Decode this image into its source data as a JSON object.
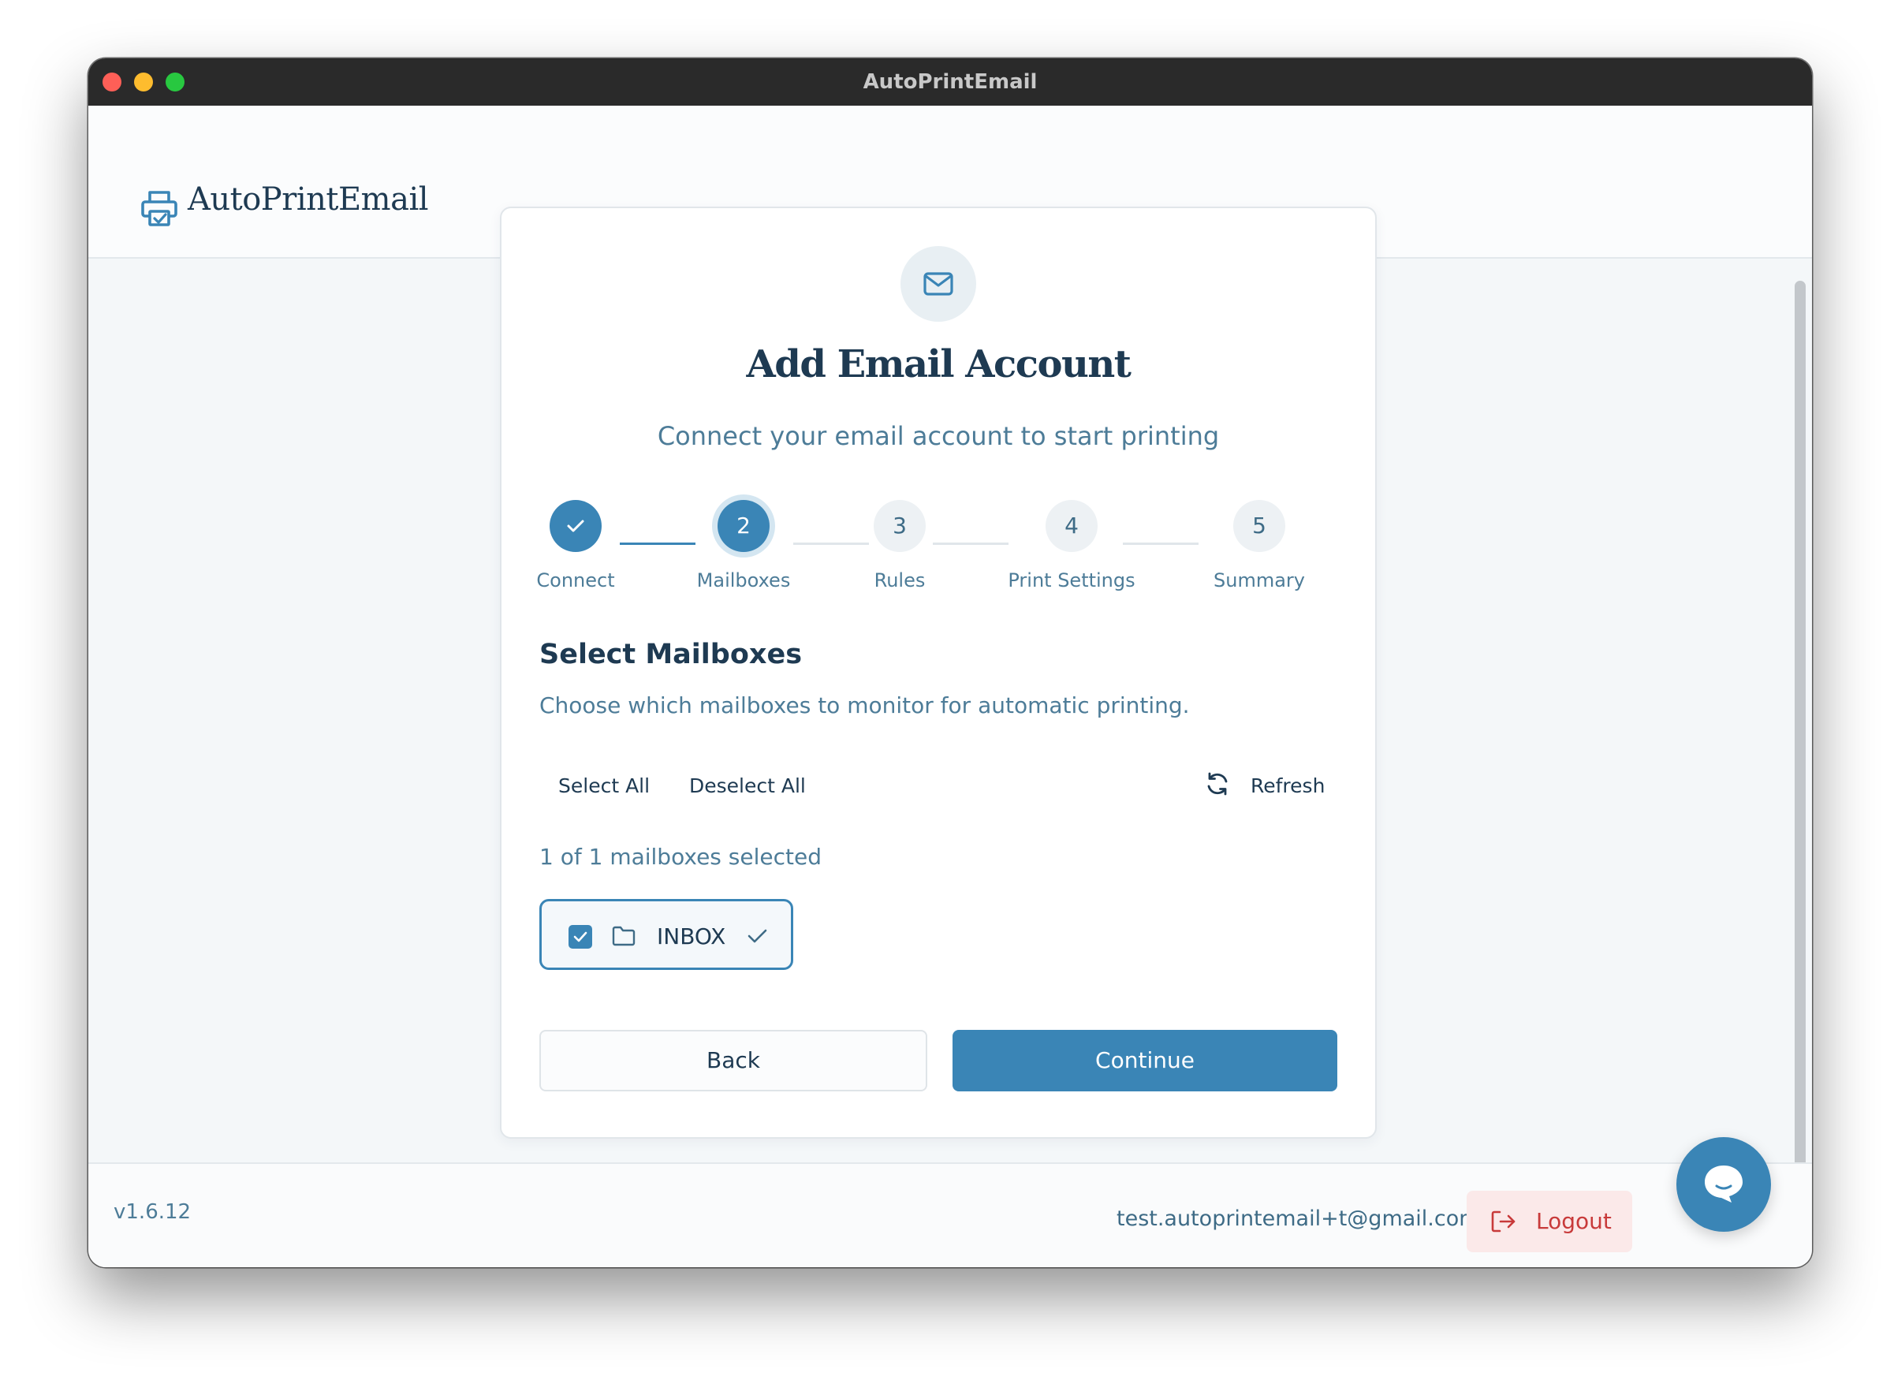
{
  "window": {
    "title": "AutoPrintEmail"
  },
  "header": {
    "app_name": "AutoPrintEmail",
    "logo_icon": "printer-icon"
  },
  "card": {
    "icon": "mail-icon",
    "title": "Add Email Account",
    "subtitle": "Connect your email account to start printing"
  },
  "stepper": {
    "steps": [
      {
        "number": "1",
        "label": "Connect",
        "state": "done"
      },
      {
        "number": "2",
        "label": "Mailboxes",
        "state": "active"
      },
      {
        "number": "3",
        "label": "Rules",
        "state": "todo"
      },
      {
        "number": "4",
        "label": "Print Settings",
        "state": "todo"
      },
      {
        "number": "5",
        "label": "Summary",
        "state": "todo"
      }
    ]
  },
  "mailboxes": {
    "title": "Select Mailboxes",
    "description": "Choose which mailboxes to monitor for automatic printing.",
    "select_all_label": "Select All",
    "deselect_all_label": "Deselect All",
    "refresh_label": "Refresh",
    "count_text": "1 of 1 mailboxes selected",
    "items": [
      {
        "name": "INBOX",
        "selected": true
      }
    ]
  },
  "actions": {
    "back_label": "Back",
    "continue_label": "Continue"
  },
  "footer": {
    "version": "v1.6.12",
    "user_email": "test.autoprintemail+t@gmail.com",
    "logout_label": "Logout"
  },
  "colors": {
    "primary": "#3a85b6",
    "title_text": "#1e3a52",
    "muted_text": "#4d7c98",
    "logout_bg": "#fbe9e9",
    "logout_text": "#c83a3a"
  }
}
